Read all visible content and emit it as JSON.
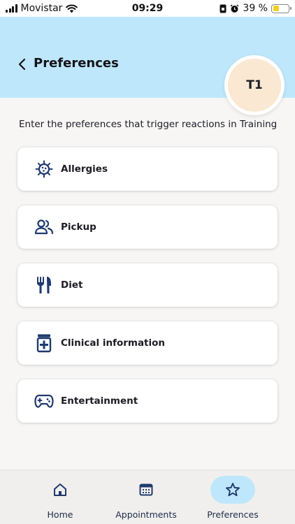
{
  "status_bar": {
    "carrier": "Movistar",
    "time": "09:29",
    "battery_text": "39 %",
    "battery_level": 0.39
  },
  "header": {
    "title": "Preferences",
    "avatar_initials": "T1"
  },
  "intro_text": "Enter the preferences that trigger reactions in Training",
  "preferences": [
    {
      "label": "Allergies",
      "icon": "virus-icon"
    },
    {
      "label": "Pickup",
      "icon": "people-icon"
    },
    {
      "label": "Diet",
      "icon": "cutlery-icon"
    },
    {
      "label": "Clinical information",
      "icon": "medicine-jar-icon"
    },
    {
      "label": "Entertainment",
      "icon": "gamepad-icon"
    }
  ],
  "tab_bar": {
    "tabs": [
      {
        "label": "Home",
        "icon": "home-icon",
        "active": false
      },
      {
        "label": "Appointments",
        "icon": "calendar-icon",
        "active": false
      },
      {
        "label": "Preferences",
        "icon": "star-icon",
        "active": true
      }
    ]
  },
  "colors": {
    "header_bg": "#bfe7fb",
    "icon_navy": "#1f3a6e",
    "avatar_bg": "#fbe8d2",
    "battery_fill": "#f2cf1a"
  }
}
